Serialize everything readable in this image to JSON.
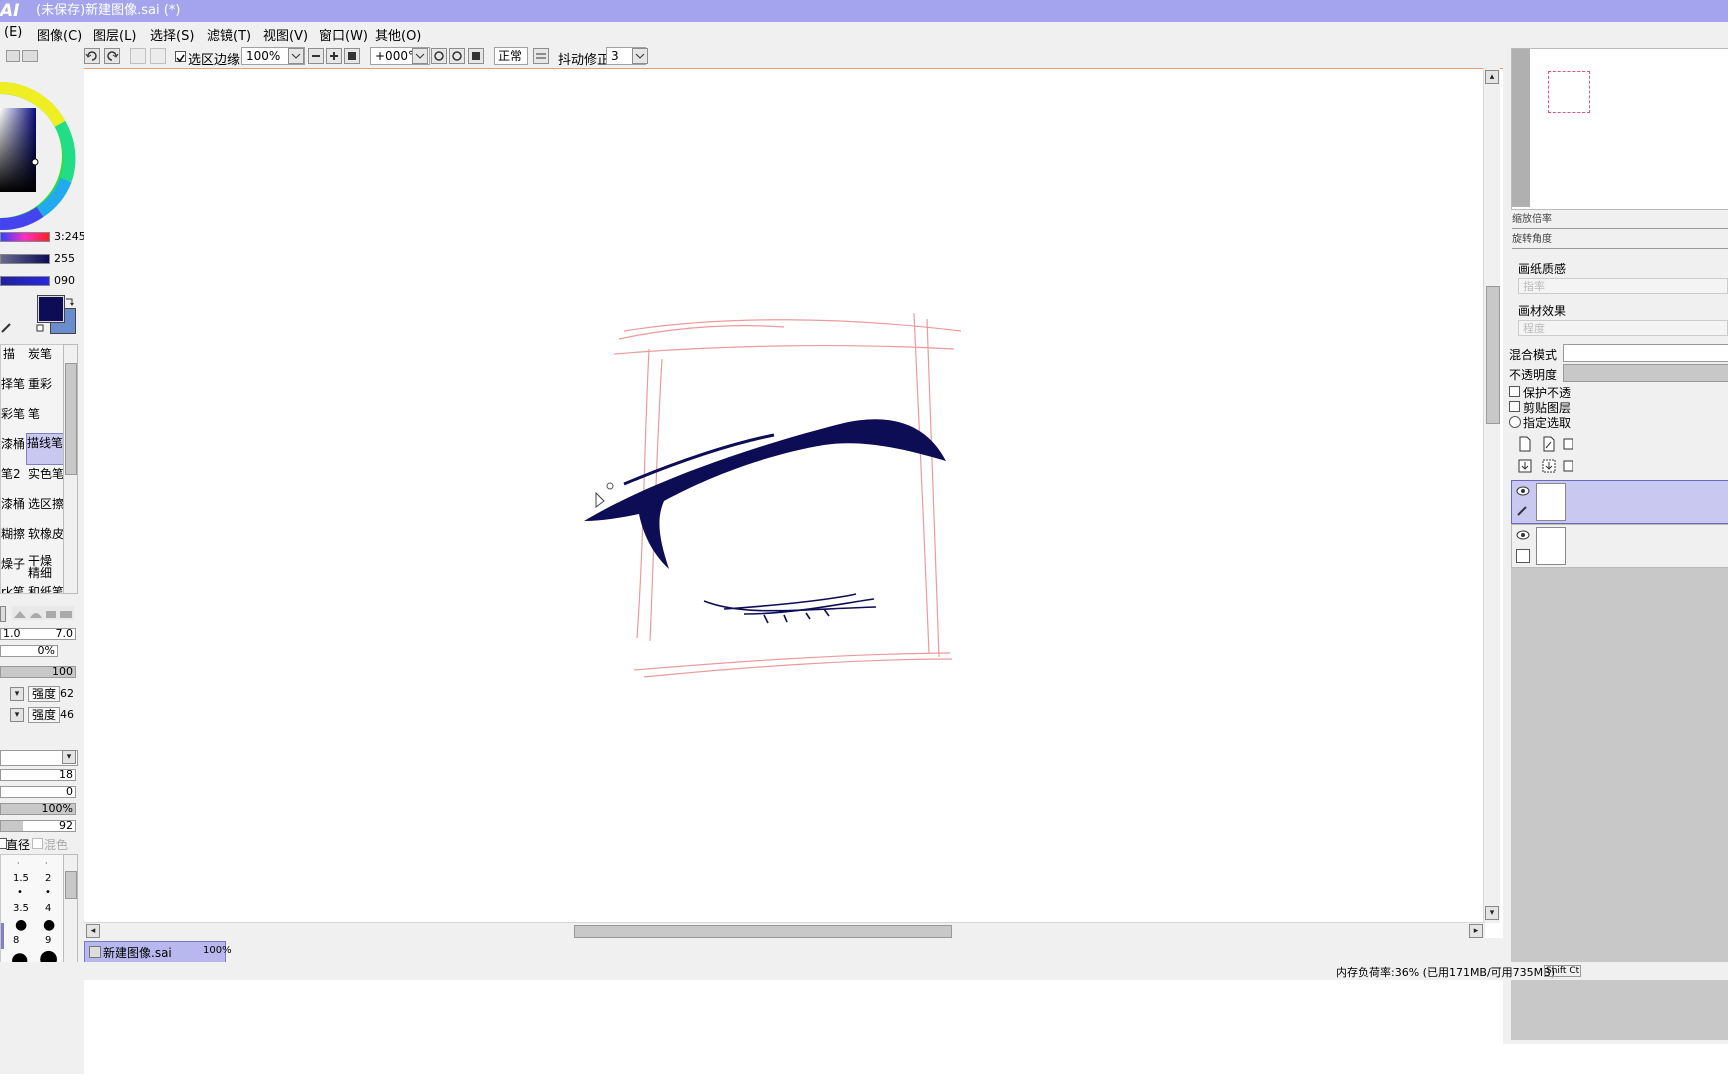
{
  "window": {
    "app_logo": "AI",
    "title": "(未保存)新建图像.sai (*)"
  },
  "menu": [
    {
      "label": "图像(C)"
    },
    {
      "label": "图层(L)"
    },
    {
      "label": "选择(S)"
    },
    {
      "label": "滤镜(T)"
    },
    {
      "label": "视图(V)"
    },
    {
      "label": "窗口(W)"
    },
    {
      "label": "其他(O)"
    }
  ],
  "menu_partial": "(E)",
  "toolbar": {
    "selection_edge_label": "选区边缘",
    "selection_edge_checked": true,
    "zoom_value": "100%",
    "rotation_value": "+000°",
    "blend_mode_value": "正常",
    "stabilizer_label": "抖动修正",
    "stabilizer_value": "3"
  },
  "colors": {
    "primary": "#0d0d56",
    "secondary": "#6a8dd0",
    "title_bar": "#a4a4ee",
    "guide_sketch": "#e88a8a"
  },
  "color_sliders": {
    "hue_value": "3:245",
    "sat_value": "255",
    "val_value": "090"
  },
  "tools": [
    {
      "label": "描"
    },
    {
      "label": "炭笔"
    },
    {
      "label": "择笔"
    },
    {
      "label": "重彩"
    },
    {
      "label": "彩笔"
    },
    {
      "label": "笔"
    },
    {
      "label": "漆桶"
    },
    {
      "label": "描线笔"
    },
    {
      "label": "笔2"
    },
    {
      "label": "实色笔"
    },
    {
      "label": "漆桶"
    },
    {
      "label": "选区擦"
    },
    {
      "label": "糊擦"
    },
    {
      "label": "软橡皮"
    },
    {
      "label": "燥子"
    },
    {
      "label": "干燥精细"
    },
    {
      "label": "rk笔"
    },
    {
      "label": "和纸笔"
    }
  ],
  "brush_settings": {
    "size_min": "1.0",
    "size_max": "7.0",
    "min_size_pct": "0%",
    "density": "100",
    "texture_strength_label": "强度",
    "texture_strength": "62",
    "effect_strength_label": "强度",
    "effect_strength": "46",
    "blending": "18",
    "dilution": "0",
    "persistence": "100%",
    "extra": "92",
    "diameter_label": "直径",
    "mix_label": "混色"
  },
  "brush_sizes": [
    "1.5",
    "2",
    "3.5",
    "4",
    "8",
    "9"
  ],
  "navigator": {
    "zoom_label": "缩放倍率",
    "rotation_label": "旋转角度"
  },
  "layer_panel": {
    "paper_texture_label": "画纸质感",
    "paper_texture_placeholder": "指率",
    "canvas_effect_label": "画材效果",
    "canvas_effect_placeholder": "程度",
    "blend_mode_label": "混合模式",
    "opacity_label": "不透明度",
    "protect_opacity_label": "保护不透",
    "clip_group_label": "剪贴图层",
    "selection_source_label": "指定选取"
  },
  "document_tab": {
    "name": "新建图像.sai",
    "zoom": "100%"
  },
  "status": {
    "memory": "内存负荷率:36% (已用171MB/可用735MB)",
    "keys": "Shift Ct"
  }
}
